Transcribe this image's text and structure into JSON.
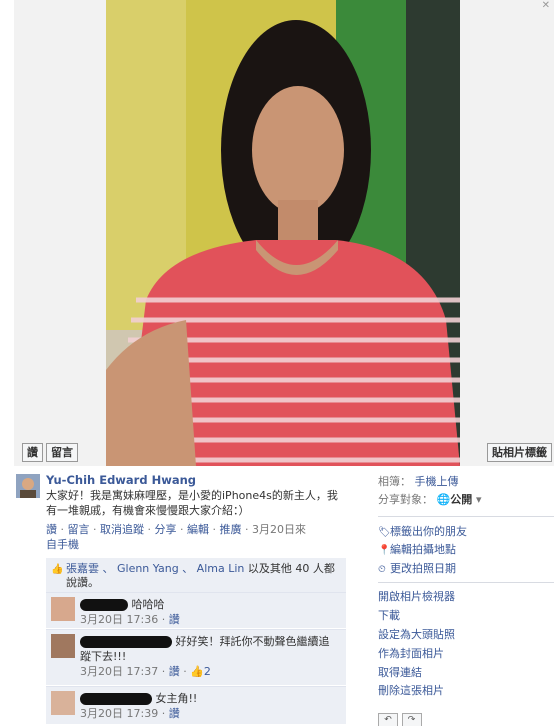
{
  "photo": {
    "like_button": "讚",
    "comment_button": "留言",
    "tag_button": "貼相片標籤"
  },
  "post": {
    "author": "Yu-Chih Edward Hwang",
    "caption": "大家好！我是寓妹麻哩壓，是小愛的iPhone4s的新主人，我有一堆親戚，有機會來慢慢跟大家介紹：）",
    "actions": {
      "like": "讚",
      "comment": "留言",
      "unfollow": "取消追蹤",
      "share": "分享",
      "edit": "編輯",
      "promote": "推廣",
      "date": "3月20日來",
      "source": "自手機",
      "dot": "·"
    },
    "likes": {
      "names": "張嘉雲 、 Glenn Yang 、 Alma Lin",
      "suffix": "以及其他 40 人都說讚。"
    },
    "comments": [
      {
        "text": "哈哈哈",
        "time": "3月20日 17:36",
        "like": "讚"
      },
      {
        "text": "好好笑！拜託你不動聲色繼續追蹤下去!!!",
        "time": "3月20日 17:37",
        "like": "讚",
        "likes_count": "2"
      },
      {
        "text": "女主角!!",
        "time": "3月20日 17:39",
        "like": "讚"
      }
    ]
  },
  "sidebar": {
    "album_label": "相簿：",
    "album_value": "手機上傳",
    "share_label": "分享對象：",
    "share_value": "公開",
    "tag_friends": "標籤出你的朋友",
    "edit_location": "編輯拍攝地點",
    "change_date": "更改拍照日期",
    "open_viewer": "開啟相片檢視器",
    "download": "下載",
    "set_profile": "設定為大頭貼照",
    "set_cover": "作為封面相片",
    "get_link": "取得連結",
    "delete_photo": "刪除這張相片"
  }
}
